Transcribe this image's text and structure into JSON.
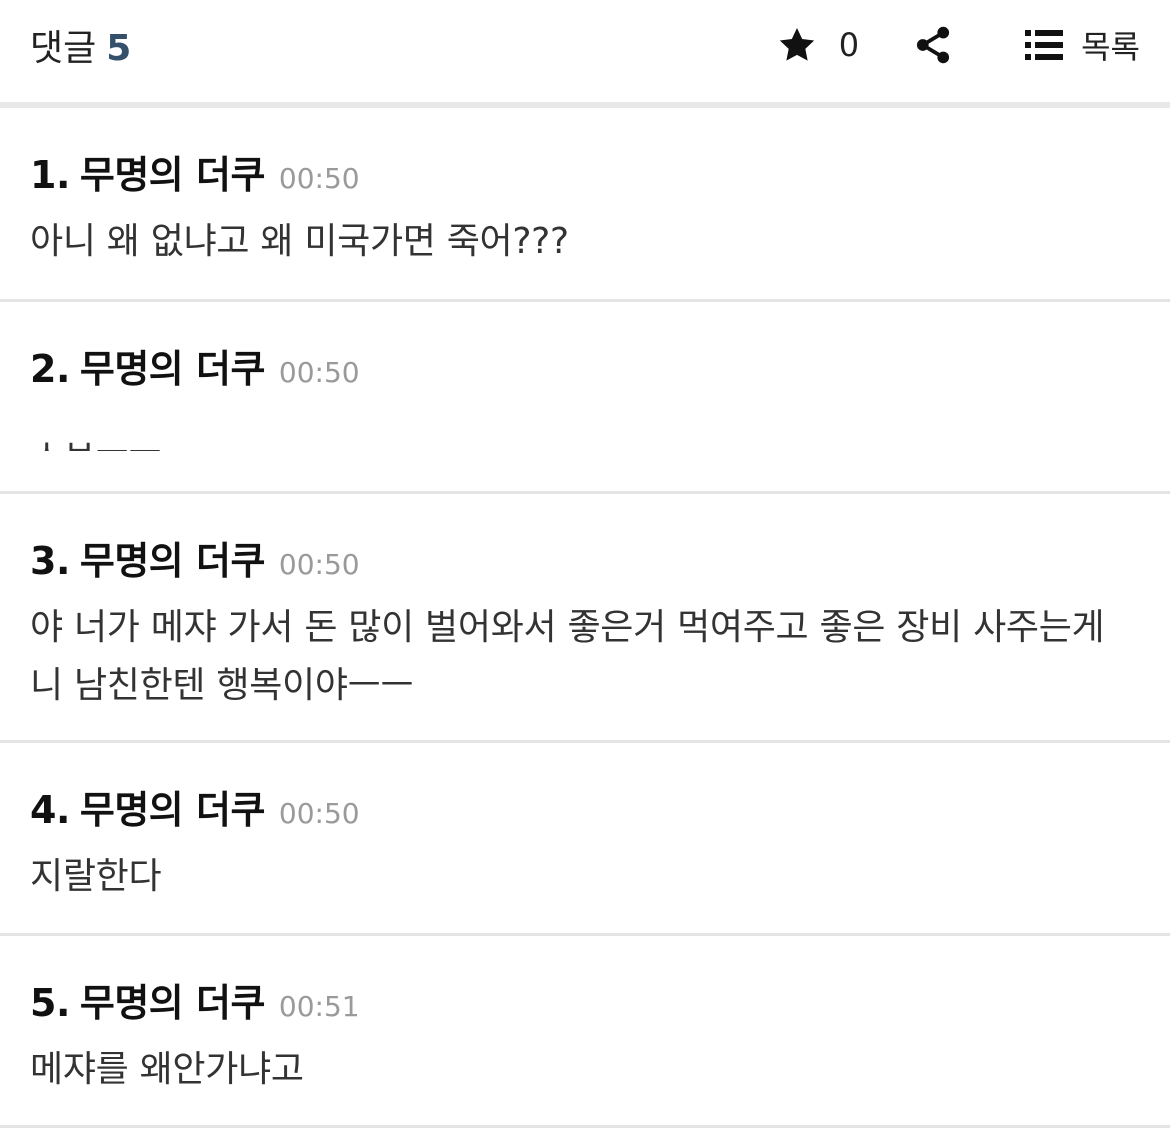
{
  "header": {
    "title": "댓글",
    "count": "5",
    "star_count": "0",
    "list_label": "목록",
    "icons": [
      "star-icon",
      "share-icon",
      "list-icon"
    ]
  },
  "comments": [
    {
      "number": "1.",
      "author": "무명의 더쿠",
      "time": "00:50",
      "text": "아니 왜 없냐고 왜 미국가면 죽어???"
    },
    {
      "number": "2.",
      "author": "무명의 더쿠",
      "time": "00:50",
      "text": "ㅅㅂㅡㅡ"
    },
    {
      "number": "3.",
      "author": "무명의 더쿠",
      "time": "00:50",
      "text": "야 너가 메쟈 가서 돈 많이 벌어와서 좋은거 먹여주고 좋은 장비 사주는게 니 남친한텐 행복이야ㅡㅡ"
    },
    {
      "number": "4.",
      "author": "무명의 더쿠",
      "time": "00:50",
      "text": "지랄한다"
    },
    {
      "number": "5.",
      "author": "무명의 더쿠",
      "time": "00:51",
      "text": "메쟈를 왜안가냐고"
    }
  ]
}
